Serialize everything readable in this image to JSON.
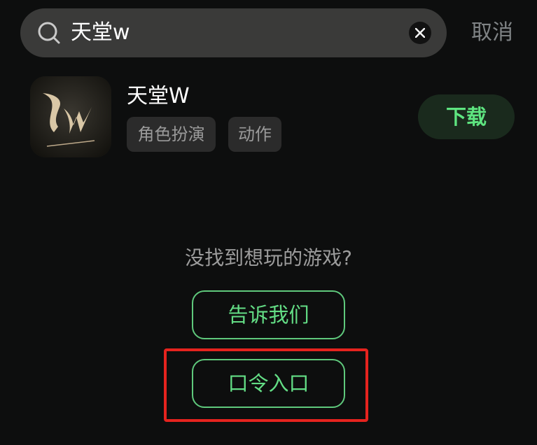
{
  "search": {
    "query": "天堂w",
    "cancel_label": "取消"
  },
  "result": {
    "title": "天堂W",
    "tags": [
      "角色扮演",
      "动作"
    ],
    "download_label": "下载"
  },
  "empty_state": {
    "prompt": "没找到想玩的游戏?",
    "tell_us_label": "告诉我们",
    "code_entry_label": "口令入口"
  },
  "colors": {
    "background": "#0d0e0e",
    "accent_green": "#5ee580",
    "highlight_red": "#e5231e"
  }
}
